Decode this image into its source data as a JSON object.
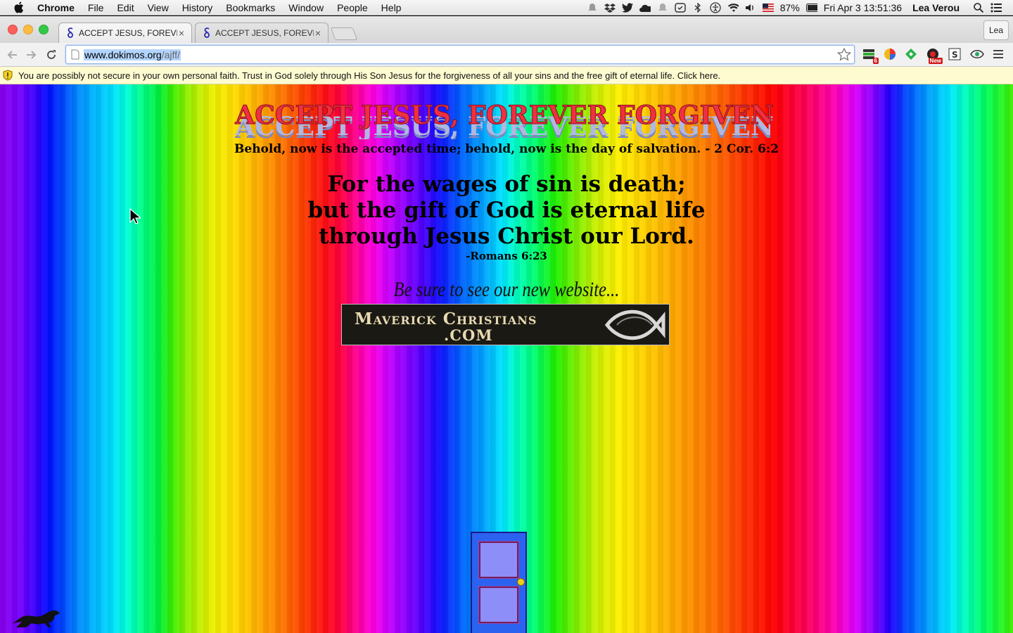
{
  "menubar": {
    "app_name": "Chrome",
    "menus": [
      "File",
      "Edit",
      "View",
      "History",
      "Bookmarks",
      "Window",
      "People",
      "Help"
    ],
    "battery": "87%",
    "datetime": "Fri Apr 3  13:51:36",
    "user": "Lea Verou",
    "status_icons": [
      "notification-icon",
      "dropbox-icon",
      "twitter-icon",
      "cloud-app-icon",
      "notification-bell-icon",
      "timer-icon",
      "bluetooth-icon",
      "accessibility-icon",
      "wifi-icon",
      "volume-icon",
      "us-flag-icon",
      "battery-icon",
      "spotlight-icon",
      "notification-center-icon"
    ]
  },
  "browser": {
    "tabs": [
      {
        "title": "ACCEPT JESUS, FOREVER FORGIVEN",
        "active": true
      },
      {
        "title": "ACCEPT JESUS, FOREVER FORGIVEN",
        "active": false
      }
    ],
    "profile": "Lea",
    "url_host": "www.dokimos.org",
    "url_path": "/ajff/",
    "extension_badge": "6",
    "extension_new_label": "New"
  },
  "infobar": {
    "message": "You are possibly not secure in your own personal faith. Trust in God solely through His Son Jesus for the forgiveness of all your sins and the free gift of eternal life. Click here."
  },
  "page": {
    "banner_text": "ACCEPT JESUS, FOREVER FORGIVEN",
    "verse_small": "Behold, now is the accepted time; behold, now is the day of salvation. - 2 Cor. 6:2",
    "verse_lines": [
      "For the wages of sin is death;",
      "but the gift of God is eternal life",
      "through Jesus Christ our Lord."
    ],
    "verse_ref": "-Romans 6:23",
    "be_sure": "Be sure to see our new website...",
    "maverick_line1": "Maverick Christians",
    "maverick_line2": ".COM"
  },
  "colors": {
    "banner_fill": "#f03040",
    "banner_shadow": "#9aa6d8",
    "infobar_bg": "#fefbd1",
    "door_blue": "#2b62f0",
    "door_panel": "#8e8ef8"
  }
}
